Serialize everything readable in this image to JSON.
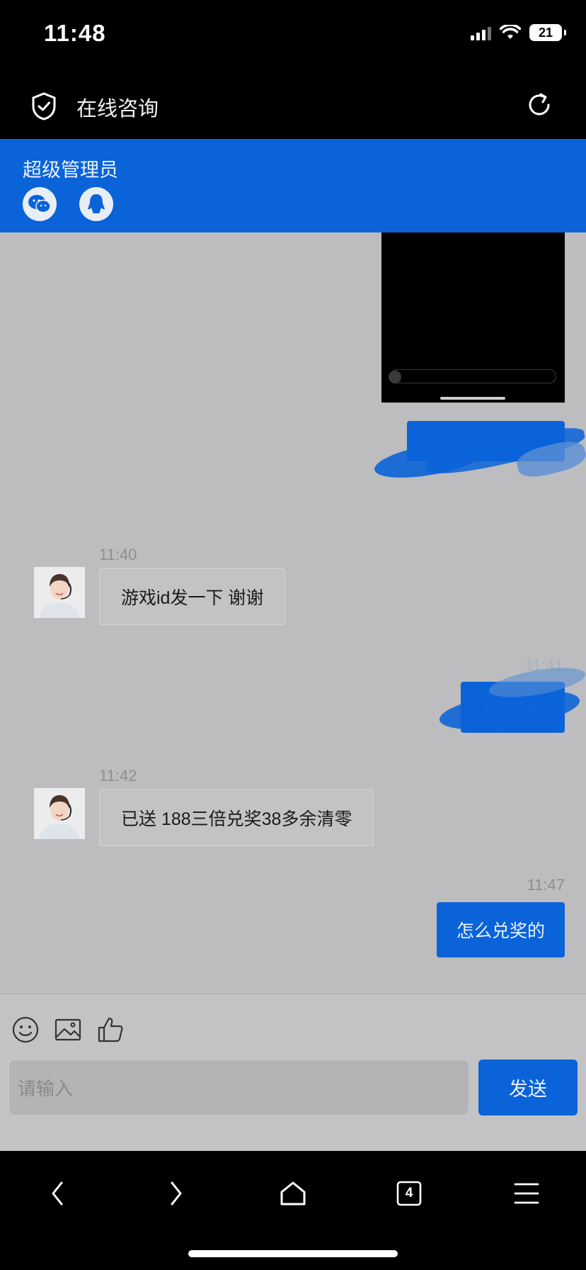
{
  "status_bar": {
    "time": "11:48",
    "battery": "21",
    "icons": [
      "signal-icon",
      "wifi-icon",
      "battery-icon"
    ]
  },
  "header": {
    "title": "在线咨询",
    "left_icon": "shield-check-icon",
    "right_icon": "refresh-icon"
  },
  "banner": {
    "name": "超级管理员",
    "icons": [
      "wechat-icon",
      "qq-icon"
    ],
    "color": "#0a63d8"
  },
  "messages": [
    {
      "side": "out",
      "type": "image",
      "content": "",
      "time": ""
    },
    {
      "side": "out",
      "type": "text-redacted",
      "content": "",
      "time": ""
    },
    {
      "side": "in",
      "type": "text",
      "time": "11:40",
      "content": "游戏id发一下 谢谢"
    },
    {
      "side": "out",
      "type": "text-redacted",
      "time": "11:41",
      "content": "529213"
    },
    {
      "side": "in",
      "type": "text",
      "time": "11:42",
      "content": "已送 188三倍兑奖38多余清零"
    },
    {
      "side": "out",
      "type": "text",
      "time": "11:47",
      "content": "怎么兑奖的"
    }
  ],
  "input": {
    "placeholder": "请输入",
    "send_label": "发送",
    "tools": [
      "emoji-icon",
      "image-icon",
      "thumbs-up-icon"
    ]
  },
  "browser_bar": {
    "buttons": [
      "back-icon",
      "forward-icon",
      "home-icon",
      "tabs-icon",
      "menu-icon"
    ],
    "tab_count": "4"
  },
  "colors": {
    "accent": "#0a63d8",
    "overlay": "#bdbdbf"
  }
}
